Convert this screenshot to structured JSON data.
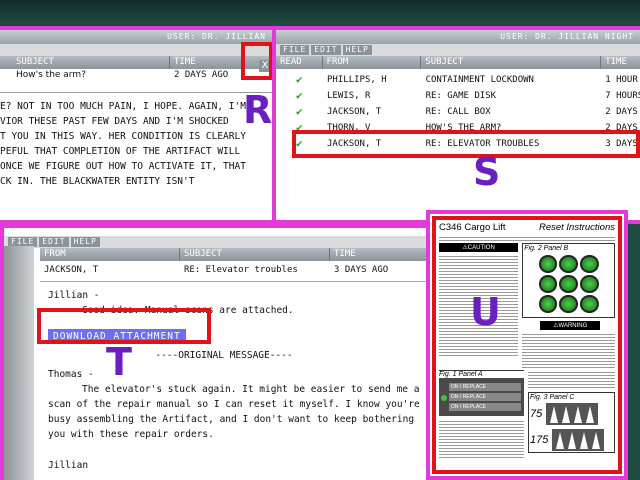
{
  "window_r": {
    "close_label": "X",
    "user_label": "USER: DR. JILLIAN",
    "columns": [
      "SUBJECT",
      "TIME"
    ],
    "row": {
      "subject": "How's the arm?",
      "time": "2 DAYS AGO"
    },
    "body_lines": [
      "E? NOT IN TOO MUCH PAIN, I HOPE. AGAIN, I'M",
      "VIOR THESE PAST FEW DAYS AND I'M SHOCKED",
      "T YOU IN THIS WAY. HER CONDITION IS CLEARLY",
      "PEFUL THAT COMPLETION OF THE ARTIFACT WILL",
      "ONCE WE FIGURE OUT HOW TO ACTIVATE IT, THAT",
      "CK IN. THE BLACKWATER ENTITY ISN'T"
    ]
  },
  "window_s": {
    "user_label": "USER: DR. JILLIAN NIGHT",
    "menu": [
      "FILE",
      "EDIT",
      "HELP"
    ],
    "columns": [
      "READ",
      "FROM",
      "SUBJECT",
      "TIME"
    ],
    "rows": [
      {
        "read": "✔",
        "from": "PHILLIPS, H",
        "subject": "CONTAINMENT LOCKDOWN",
        "time": "1 HOUR"
      },
      {
        "read": "✔",
        "from": "LEWIS, R",
        "subject": "RE: GAME DISK",
        "time": "7 HOURS"
      },
      {
        "read": "✔",
        "from": "JACKSON, T",
        "subject": "RE: CALL BOX",
        "time": "2 DAYS"
      },
      {
        "read": "✔",
        "from": "THORN, V",
        "subject": "HOW'S THE ARM?",
        "time": "2 DAYS"
      },
      {
        "read": "✔",
        "from": "JACKSON, T",
        "subject": "RE: ELEVATOR TROUBLES",
        "time": "3 DAYS"
      }
    ]
  },
  "window_t": {
    "menu": [
      "FILE",
      "EDIT",
      "HELP"
    ],
    "columns": [
      "FROM",
      "SUBJECT",
      "TIME"
    ],
    "row": {
      "from": "JACKSON, T",
      "subject": "RE: Elevator troubles",
      "time": "3 DAYS AGO"
    },
    "greeting": "Jillian -",
    "reply": "Good idea. Manual scans are attached.",
    "download_label": "DOWNLOAD ATTACHMENT",
    "original_marker": "----ORIGINAL MESSAGE----",
    "thomas": "Thomas -",
    "original_lines": [
      "The elevator's stuck again. It might be easier to send me a",
      "scan of the repair manual so I can reset it myself. I know you're",
      "busy assembling the Artifact, and I don't want to keep bothering",
      "you with these repair orders."
    ],
    "signoff": "Jillian"
  },
  "document_u": {
    "title": "C346 Cargo Lift",
    "subtitle": "Reset Instructions",
    "caution": "⚠CAUTION",
    "warning": "⚠WARNING",
    "fig2": "Fig. 2 Panel B",
    "fig1": "Fig. 1 Panel A",
    "fig3": "Fig. 3 Panel C",
    "panel_a_buttons": [
      "ON / REPLACE",
      "ON / REPLACE",
      "ON / REPLACE"
    ],
    "fig3_values": [
      "75",
      "175"
    ]
  },
  "markers": {
    "r": "R",
    "s": "S",
    "t": "T",
    "u": "U"
  },
  "colors": {
    "highlight_box": "#e0131b",
    "window_border": "#e23ad8",
    "marker_letter": "#6a1fbf",
    "download_button": "#6b6ff0"
  }
}
